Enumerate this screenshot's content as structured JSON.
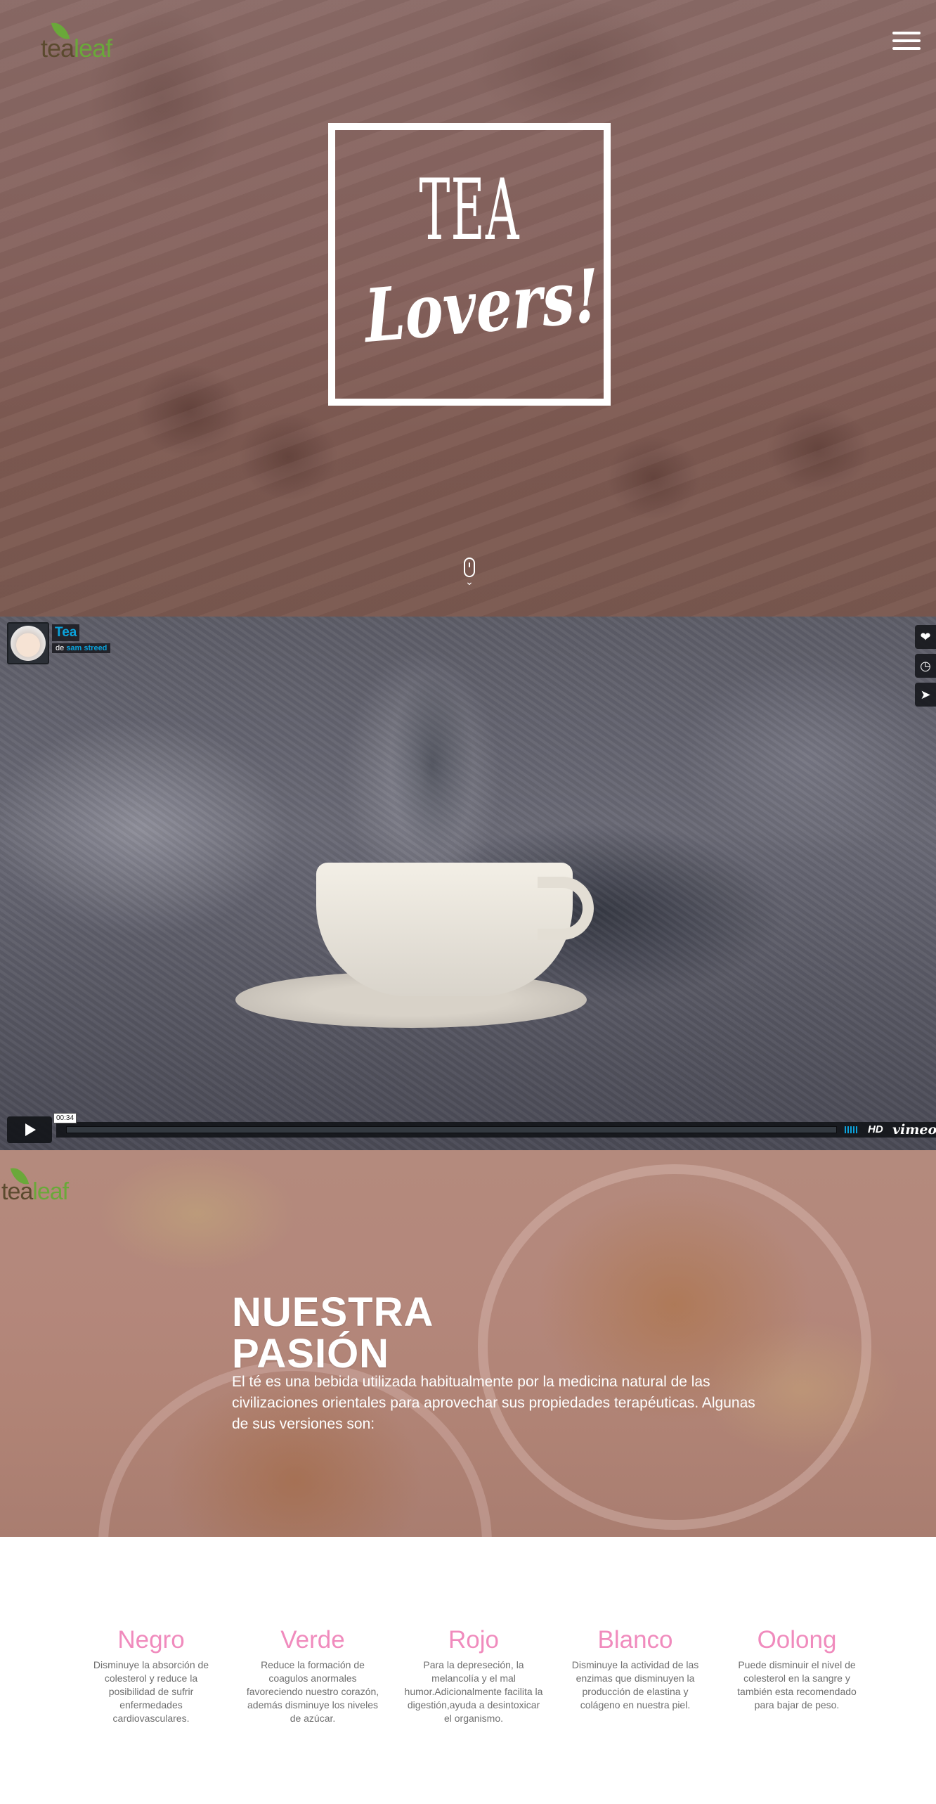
{
  "brand": {
    "logo_text_1": "tea",
    "logo_text_2": "leaf"
  },
  "hero": {
    "title_line_1": "TEA",
    "title_line_2": "Lovers!"
  },
  "video": {
    "title": "Tea",
    "by_prefix": "de",
    "author": "sam streed",
    "time": "00:34",
    "hd_label": "HD",
    "brand_label": "vimeo"
  },
  "passion": {
    "title_line_1": "NUESTRA",
    "title_line_2": "PASIÓN",
    "text": "El té es una bebida utilizada habitualmente por la medicina natural de las civilizaciones orientales para aprovechar sus propiedades terapéuticas. Algunas de sus versiones son:"
  },
  "teas": [
    {
      "name": "Negro",
      "desc": "Disminuye la absorción de colesterol y reduce la posibilidad de sufrir enfermedades cardiovasculares."
    },
    {
      "name": "Verde",
      "desc": "Reduce la formación de coagulos anormales favoreciendo nuestro corazón, además disminuye los niveles de azúcar."
    },
    {
      "name": "Rojo",
      "desc": "Para la depreseción, la melancolía y el mal humor.Adicionalmente facilita la digestión,ayuda a desintoxicar el organismo."
    },
    {
      "name": "Blanco",
      "desc": "Disminuye la actividad de las enzimas que disminuyen la producción de elastina y colágeno en nuestra piel."
    },
    {
      "name": "Oolong",
      "desc": "Puede disminuir el nivel de colesterol en la sangre y también esta recomendado para bajar de peso."
    }
  ],
  "colors": {
    "accent_pink": "#f08bbd",
    "logo_green": "#6aa83a",
    "vimeo_blue": "#0ba3dc"
  },
  "icons": {
    "menu": "hamburger-icon",
    "scroll": "mouse-scroll-icon",
    "like": "heart-icon",
    "watch_later": "clock-icon",
    "share": "paper-plane-icon",
    "play": "play-icon"
  }
}
